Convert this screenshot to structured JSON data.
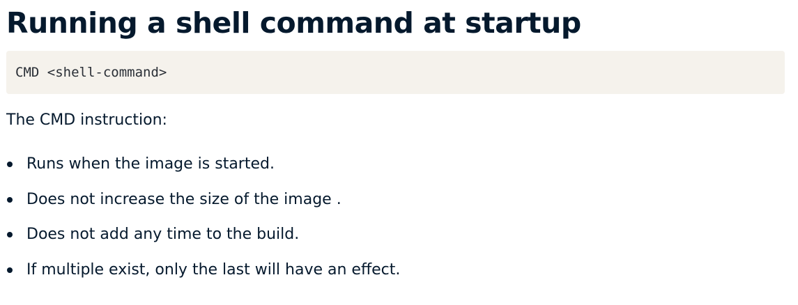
{
  "heading": {
    "title": "Running a shell command at startup"
  },
  "code": {
    "text": "CMD <shell-command>"
  },
  "intro": {
    "text": "The CMD instruction:"
  },
  "bullets": [
    "Runs when the image is started.",
    "Does not increase the size of the image .",
    "Does not add any time to the build.",
    "If multiple exist, only the last will have an effect."
  ],
  "colors": {
    "text": "#05192d",
    "code_background": "#f5f2ec",
    "code_text": "#2a2f36"
  }
}
